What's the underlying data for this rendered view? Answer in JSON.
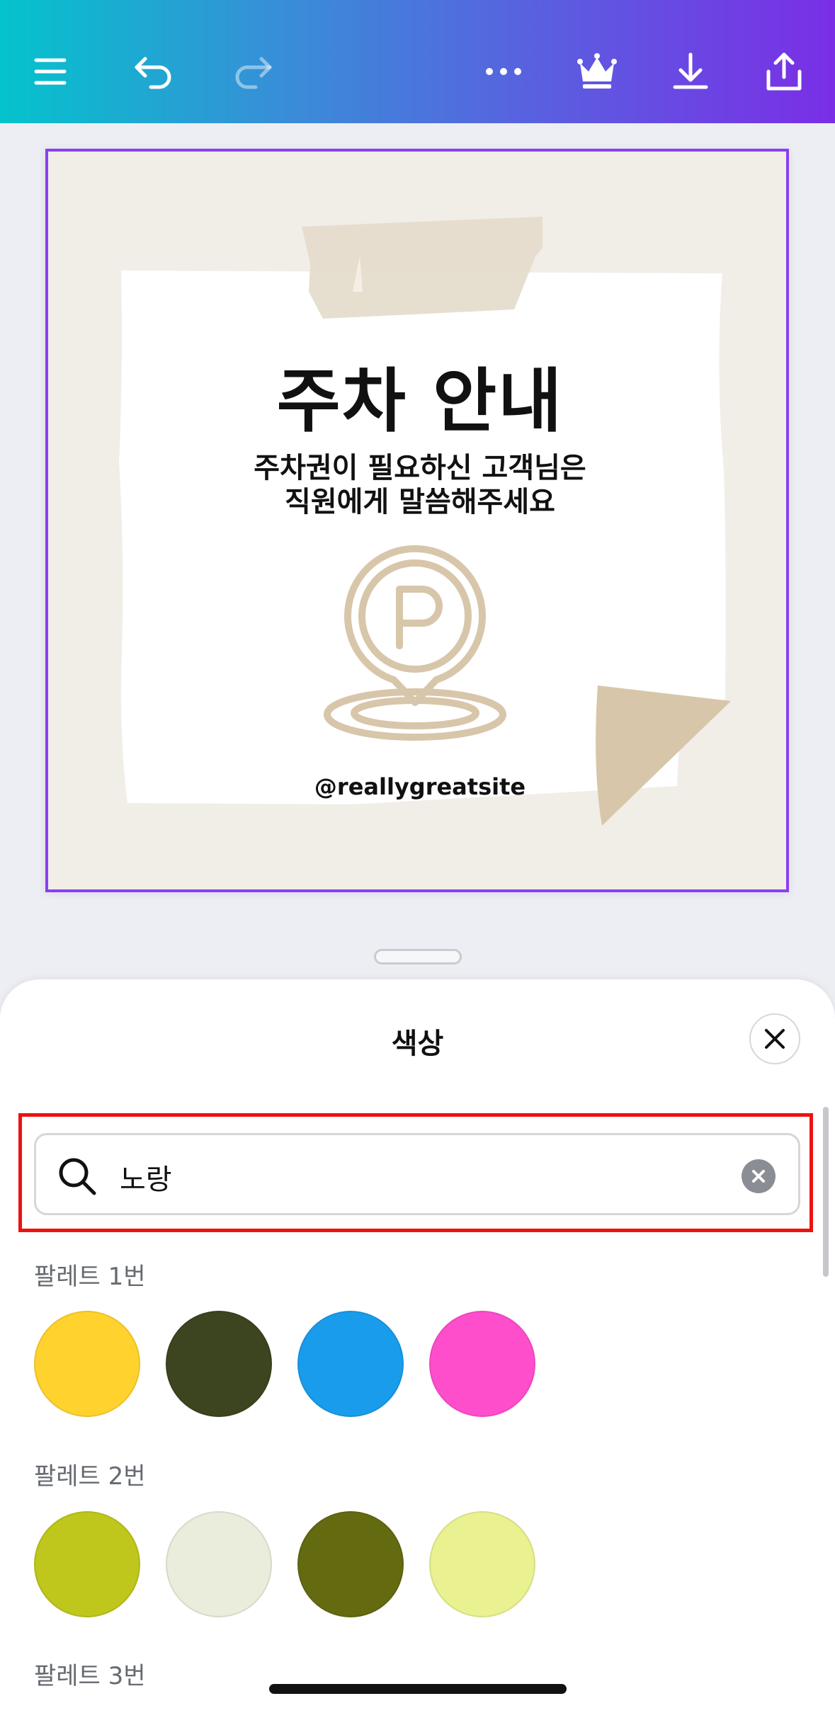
{
  "toolbar": {
    "icons": [
      "menu-icon",
      "undo-icon",
      "redo-icon",
      "more-icon",
      "premium-crown-icon",
      "download-icon",
      "share-icon"
    ],
    "gradient": [
      "#04c3cc",
      "#7a2ee6"
    ]
  },
  "design": {
    "title": "주차 안내",
    "subtitle_line1": "주차권이 필요하신 고객님은",
    "subtitle_line2": "직원에게 말씀해주세요",
    "handle": "@reallygreatsite",
    "icon": "parking-pin-icon",
    "selection_color": "#8b3ff0"
  },
  "sheet": {
    "title": "색상",
    "search": {
      "value": "노랑",
      "icon": "search-icon"
    },
    "palettes": [
      {
        "label": "팔레트 1번",
        "colors": [
          "#ffd22e",
          "#3c4420",
          "#1a9ced",
          "#ff4ecc"
        ]
      },
      {
        "label": "팔레트 2번",
        "colors": [
          "#bfc61c",
          "#eaecdc",
          "#636a10",
          "#e9f190"
        ]
      },
      {
        "label": "팔레트 3번",
        "colors": []
      }
    ]
  }
}
